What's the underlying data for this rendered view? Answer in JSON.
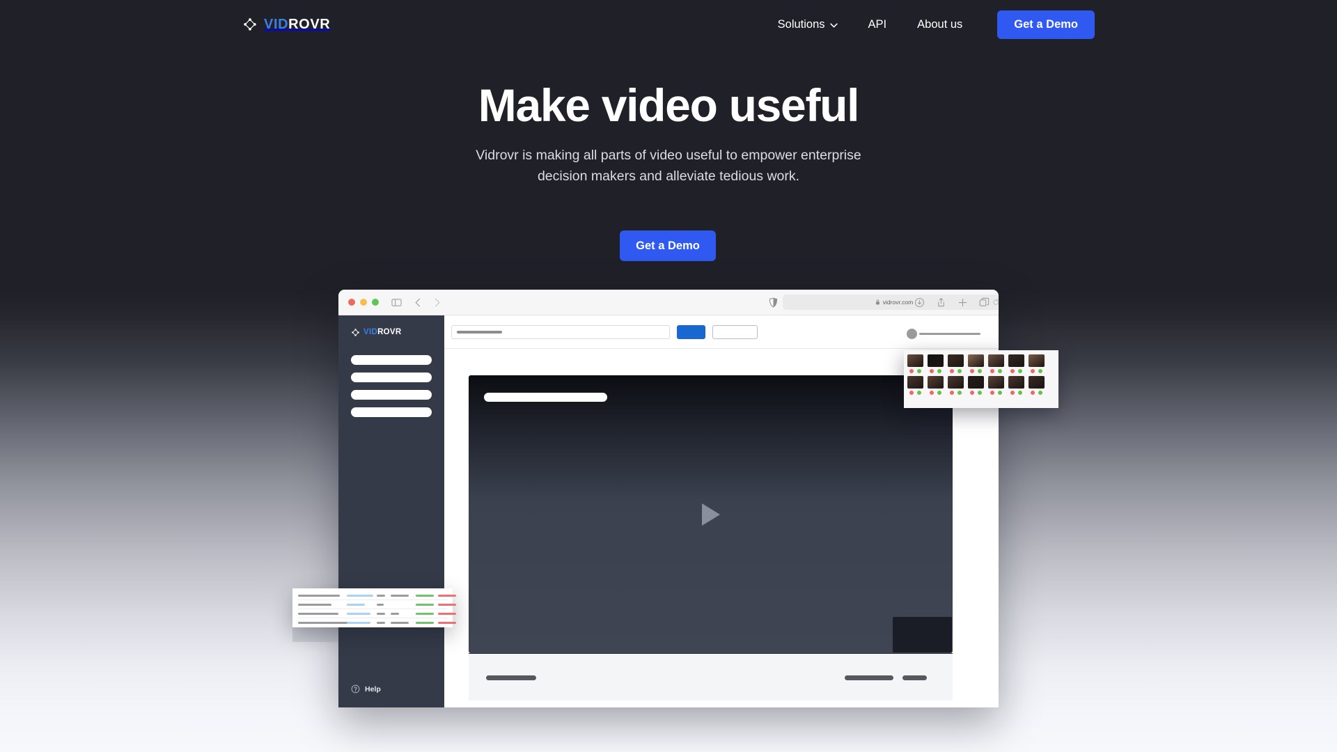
{
  "brand": {
    "name_part1": "VID",
    "name_part2": "ROVR",
    "logo_icon": "diamond-network-icon",
    "accent_blue": "#3d7ee6",
    "button_blue": "#2f59f0"
  },
  "nav": {
    "items": [
      {
        "label": "Solutions",
        "has_dropdown": true,
        "icon": "chevron-down-icon"
      },
      {
        "label": "API",
        "has_dropdown": false
      },
      {
        "label": "About us",
        "has_dropdown": false
      }
    ],
    "cta_label": "Get a Demo"
  },
  "hero": {
    "headline": "Make video useful",
    "subheadline": "Vidrovr is making all parts of video useful to empower enterprise decision makers and alleviate tedious work.",
    "cta_label": "Get a Demo"
  },
  "browser": {
    "traffic_lights": [
      "red",
      "yellow",
      "green"
    ],
    "icons": {
      "sidebar": "sidebar-toggle-icon",
      "back": "chevron-left-icon",
      "forward": "chevron-right-icon",
      "shield": "privacy-shield-icon",
      "lock": "lock-icon",
      "reload": "reload-icon",
      "download": "download-icon",
      "share": "share-icon",
      "new_tab": "plus-icon",
      "tabs": "tab-overview-icon"
    },
    "url": "vidrovr.com"
  },
  "app": {
    "sidebar": {
      "logo_part1": "VID",
      "logo_part2": "ROVR",
      "nav_placeholders": 4,
      "help_label": "Help",
      "help_icon": "question-circle-icon"
    },
    "toolbar": {
      "search_placeholder": "",
      "primary_button_label": "",
      "secondary_button_label": "",
      "slider_value": 0,
      "slider_icon": "slider-handle-icon"
    },
    "player": {
      "play_icon": "play-triangle-icon",
      "title_placeholder": ""
    },
    "footer_controls": 3
  },
  "thumbnail_grid": {
    "columns": 7,
    "rows": 2,
    "dot_red": "#ef6767",
    "dot_green": "#68c143",
    "thumb_colors": [
      [
        "#6b4c3c",
        "#121212",
        "#3c2a22",
        "#8a6a52",
        "#6d5244",
        "#332723",
        "#7a5a46"
      ],
      [
        "#4a3730",
        "#5a4038",
        "#4d372f",
        "#241c1a",
        "#5b4338",
        "#4a342c",
        "#3a2a24"
      ]
    ]
  },
  "table_card": {
    "rows": [
      {
        "c1": 60,
        "c2": 38,
        "c3": 12,
        "c4": 26,
        "c5": true,
        "c6": true
      },
      {
        "c1": 48,
        "c2": 26,
        "c3": 10,
        "c4": 0,
        "c5": true,
        "c6": true
      },
      {
        "c1": 58,
        "c2": 34,
        "c3": 12,
        "c4": 12,
        "c5": true,
        "c6": true
      },
      {
        "c1": 72,
        "c2": 34,
        "c3": 12,
        "c4": 26,
        "c5": true,
        "c6": true
      }
    ]
  }
}
